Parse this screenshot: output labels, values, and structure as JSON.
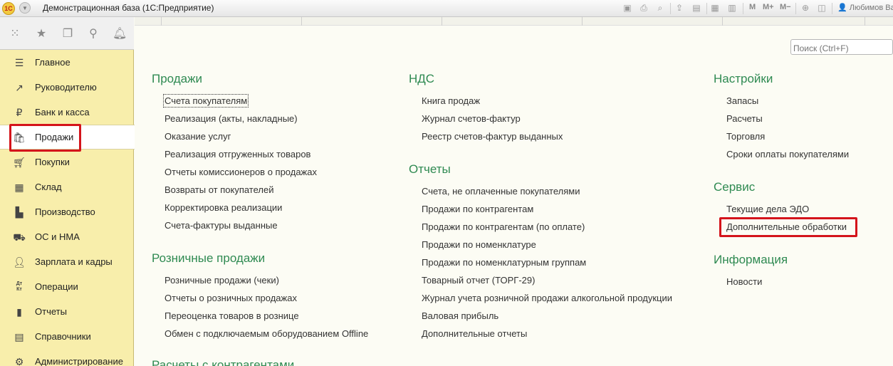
{
  "window": {
    "logo_text": "1С",
    "title": "Демонстрационная база  (1С:Предприятие)",
    "toolbar": {
      "m": "M",
      "m_plus": "M+",
      "m_minus": "M−"
    },
    "user": "Любимов Ва"
  },
  "sidebar": {
    "items": [
      {
        "label": "Главное",
        "icon": "menu-lines-icon"
      },
      {
        "label": "Руководителю",
        "icon": "trend-up-icon"
      },
      {
        "label": "Банк и касса",
        "icon": "ruble-coin-icon"
      },
      {
        "label": "Продажи",
        "icon": "shopping-bag-icon"
      },
      {
        "label": "Покупки",
        "icon": "cart-icon"
      },
      {
        "label": "Склад",
        "icon": "grid-icon"
      },
      {
        "label": "Производство",
        "icon": "factory-icon"
      },
      {
        "label": "ОС и НМА",
        "icon": "truck-icon"
      },
      {
        "label": "Зарплата и кадры",
        "icon": "person-icon"
      },
      {
        "label": "Операции",
        "icon": "debit-credit-icon"
      },
      {
        "label": "Отчеты",
        "icon": "bar-chart-icon"
      },
      {
        "label": "Справочники",
        "icon": "book-icon"
      },
      {
        "label": "Администрирование",
        "icon": "gear-icon"
      }
    ],
    "debit_credit_glyph": "Дт Кт"
  },
  "search": {
    "placeholder": "Поиск (Ctrl+F)"
  },
  "columns": {
    "left": {
      "sales": {
        "title": "Продажи",
        "links": [
          "Счета покупателям",
          "Реализация (акты, накладные)",
          "Оказание услуг",
          "Реализация отгруженных товаров",
          "Отчеты комиссионеров о продажах",
          "Возвраты от покупателей",
          "Корректировка реализации",
          "Счета-фактуры выданные"
        ]
      },
      "retail": {
        "title": "Розничные продажи",
        "links": [
          "Розничные продажи (чеки)",
          "Отчеты о розничных продажах",
          "Переоценка товаров в рознице",
          "Обмен с подключаемым оборудованием Offline"
        ]
      },
      "settlements": {
        "title": "Расчеты с контрагентами"
      }
    },
    "middle": {
      "vat": {
        "title": "НДС",
        "links": [
          "Книга продаж",
          "Журнал счетов-фактур",
          "Реестр счетов-фактур выданных"
        ]
      },
      "reports": {
        "title": "Отчеты",
        "links": [
          "Счета, не оплаченные покупателями",
          "Продажи по контрагентам",
          "Продажи по контрагентам (по оплате)",
          "Продажи по номенклатуре",
          "Продажи по номенклатурным группам",
          "Товарный отчет (ТОРГ-29)",
          "Журнал учета розничной продажи алкогольной продукции",
          "Валовая прибыль",
          "Дополнительные отчеты"
        ]
      }
    },
    "right": {
      "settings": {
        "title": "Настройки",
        "links": [
          "Запасы",
          "Расчеты",
          "Торговля",
          "Сроки оплаты покупателями"
        ]
      },
      "service": {
        "title": "Сервис",
        "links": [
          "Текущие дела ЭДО",
          "Дополнительные обработки"
        ]
      },
      "info": {
        "title": "Информация",
        "links": [
          "Новости"
        ]
      }
    }
  },
  "colors": {
    "section_title": "#2f8a52",
    "sidebar_bg": "#f8eeab",
    "highlight": "#d4141b"
  }
}
